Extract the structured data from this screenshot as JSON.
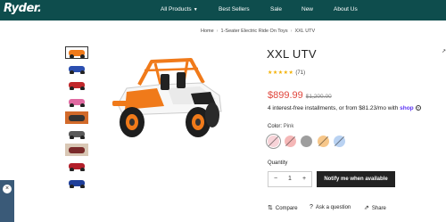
{
  "header": {
    "logo": "Ryder.",
    "nav": [
      {
        "label": "All Products",
        "has_chevron": true
      },
      {
        "label": "Best Sellers"
      },
      {
        "label": "Sale"
      },
      {
        "label": "New"
      },
      {
        "label": "About Us"
      }
    ]
  },
  "breadcrumb": [
    "Home",
    "1-Seater Electric Ride On Toys",
    "XXL UTV"
  ],
  "product": {
    "title": "XXL UTV",
    "stars": "★★★★★",
    "review_count": "(71)",
    "price_now": "$899.99",
    "price_was": "$1,200.00",
    "installments_text": "4 interest-free installments, or from $81.23/mo with",
    "installments_brand": "shop",
    "info_icon": "?",
    "color_label": "Color:",
    "color_value": "Pink",
    "swatches": [
      {
        "name": "pink",
        "color": "#f7d3d8",
        "selected": true,
        "crossed": true
      },
      {
        "name": "red",
        "color": "#f5b7b7",
        "crossed": true
      },
      {
        "name": "grey",
        "color": "#9e9e9e",
        "crossed": false
      },
      {
        "name": "orange",
        "color": "#f7c78a",
        "crossed": true
      },
      {
        "name": "blue",
        "color": "#b9d2f2",
        "crossed": true
      }
    ],
    "quantity_label": "Quantity",
    "quantity_minus": "−",
    "quantity_value": "1",
    "quantity_plus": "+",
    "notify_label": "Notify me when available",
    "compare_label": "Compare",
    "ask_label": "Ask a question",
    "share_label": "Share"
  },
  "widget": {
    "close": "×"
  },
  "colors": {
    "header_bg": "#0e4d4d",
    "price": "#e0463c",
    "accent": "#f07a1a"
  }
}
